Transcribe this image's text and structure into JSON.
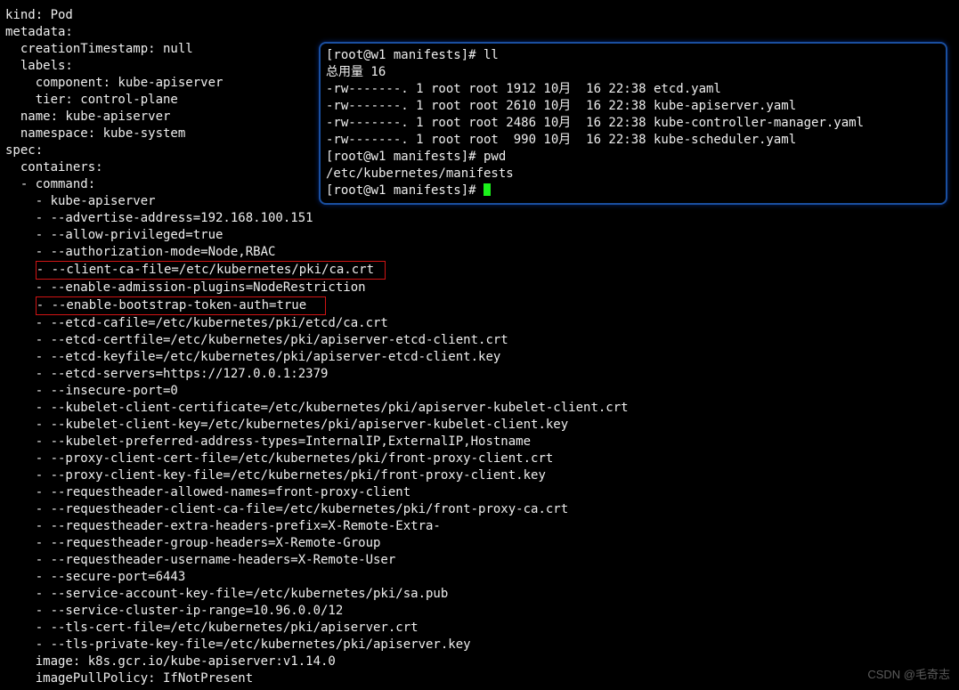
{
  "lines": [
    {
      "i": 0,
      "t": "kind: Pod"
    },
    {
      "i": 0,
      "t": "metadata:"
    },
    {
      "i": 1,
      "t": "creationTimestamp: null"
    },
    {
      "i": 1,
      "t": "labels:"
    },
    {
      "i": 2,
      "t": "component: kube-apiserver"
    },
    {
      "i": 2,
      "t": "tier: control-plane"
    },
    {
      "i": 1,
      "t": "name: kube-apiserver"
    },
    {
      "i": 1,
      "t": "namespace: kube-system"
    },
    {
      "i": 0,
      "t": "spec:"
    },
    {
      "i": 1,
      "t": "containers:"
    },
    {
      "i": 1,
      "t": "- command:"
    },
    {
      "i": 2,
      "t": "- kube-apiserver"
    },
    {
      "i": 2,
      "t": "- --advertise-address=192.168.100.151"
    },
    {
      "i": 2,
      "t": "- --allow-privileged=true"
    },
    {
      "i": 2,
      "t": "- --authorization-mode=Node,RBAC"
    },
    {
      "i": 2,
      "t": "- --client-ca-file=/etc/kubernetes/pki/ca.crt ",
      "hl": true
    },
    {
      "i": 2,
      "t": "- --enable-admission-plugins=NodeRestriction"
    },
    {
      "i": 2,
      "t": "- --enable-bootstrap-token-auth=true  ",
      "hl": true
    },
    {
      "i": 2,
      "t": "- --etcd-cafile=/etc/kubernetes/pki/etcd/ca.crt"
    },
    {
      "i": 2,
      "t": "- --etcd-certfile=/etc/kubernetes/pki/apiserver-etcd-client.crt"
    },
    {
      "i": 2,
      "t": "- --etcd-keyfile=/etc/kubernetes/pki/apiserver-etcd-client.key"
    },
    {
      "i": 2,
      "t": "- --etcd-servers=https://127.0.0.1:2379"
    },
    {
      "i": 2,
      "t": "- --insecure-port=0"
    },
    {
      "i": 2,
      "t": "- --kubelet-client-certificate=/etc/kubernetes/pki/apiserver-kubelet-client.crt"
    },
    {
      "i": 2,
      "t": "- --kubelet-client-key=/etc/kubernetes/pki/apiserver-kubelet-client.key"
    },
    {
      "i": 2,
      "t": "- --kubelet-preferred-address-types=InternalIP,ExternalIP,Hostname"
    },
    {
      "i": 2,
      "t": "- --proxy-client-cert-file=/etc/kubernetes/pki/front-proxy-client.crt"
    },
    {
      "i": 2,
      "t": "- --proxy-client-key-file=/etc/kubernetes/pki/front-proxy-client.key"
    },
    {
      "i": 2,
      "t": "- --requestheader-allowed-names=front-proxy-client"
    },
    {
      "i": 2,
      "t": "- --requestheader-client-ca-file=/etc/kubernetes/pki/front-proxy-ca.crt"
    },
    {
      "i": 2,
      "t": "- --requestheader-extra-headers-prefix=X-Remote-Extra-"
    },
    {
      "i": 2,
      "t": "- --requestheader-group-headers=X-Remote-Group"
    },
    {
      "i": 2,
      "t": "- --requestheader-username-headers=X-Remote-User"
    },
    {
      "i": 2,
      "t": "- --secure-port=6443"
    },
    {
      "i": 2,
      "t": "- --service-account-key-file=/etc/kubernetes/pki/sa.pub"
    },
    {
      "i": 2,
      "t": "- --service-cluster-ip-range=10.96.0.0/12"
    },
    {
      "i": 2,
      "t": "- --tls-cert-file=/etc/kubernetes/pki/apiserver.crt"
    },
    {
      "i": 2,
      "t": "- --tls-private-key-file=/etc/kubernetes/pki/apiserver.key"
    },
    {
      "i": 2,
      "t": "image: k8s.gcr.io/kube-apiserver:v1.14.0"
    },
    {
      "i": 2,
      "t": "imagePullPolicy: IfNotPresent"
    }
  ],
  "panel": {
    "prompt1": "[root@w1 manifests]# ll",
    "total": "总用量 16",
    "rows": [
      "-rw-------. 1 root root 1912 10月  16 22:38 etcd.yaml",
      "-rw-------. 1 root root 2610 10月  16 22:38 kube-apiserver.yaml",
      "-rw-------. 1 root root 2486 10月  16 22:38 kube-controller-manager.yaml",
      "-rw-------. 1 root root  990 10月  16 22:38 kube-scheduler.yaml"
    ],
    "prompt2": "[root@w1 manifests]# pwd",
    "pwd": "/etc/kubernetes/manifests",
    "prompt3": "[root@w1 manifests]# "
  },
  "watermark": "CSDN @毛奇志"
}
